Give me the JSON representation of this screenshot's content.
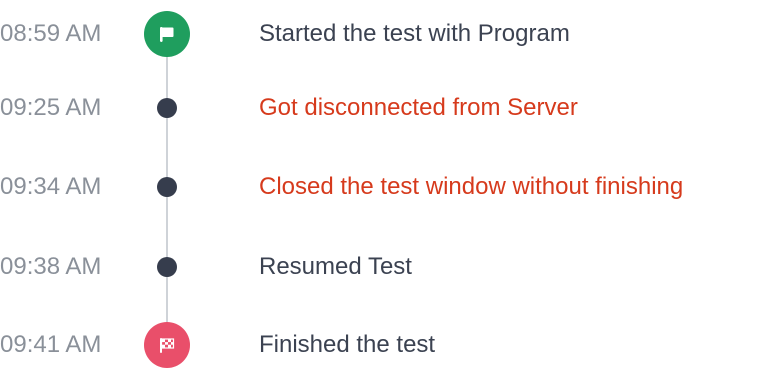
{
  "colors": {
    "time_text": "#8a9099",
    "description_text": "#3b4251",
    "error_text": "#d63a1c",
    "dot": "#363d4d",
    "start_marker": "#1f9e5e",
    "finish_marker": "#e94f6a",
    "connector": "#cfd3d8"
  },
  "events": [
    {
      "time": "08:59 AM",
      "description": "Started the test with Program",
      "marker": "flag-icon",
      "status": "normal"
    },
    {
      "time": "09:25 AM",
      "description": "Got disconnected from Server",
      "marker": "dot",
      "status": "error"
    },
    {
      "time": "09:34 AM",
      "description": "Closed the test window without finishing",
      "marker": "dot",
      "status": "error"
    },
    {
      "time": "09:38 AM",
      "description": "Resumed Test",
      "marker": "dot",
      "status": "normal"
    },
    {
      "time": "09:41 AM",
      "description": "Finished the test",
      "marker": "checkered-flag-icon",
      "status": "normal"
    }
  ]
}
